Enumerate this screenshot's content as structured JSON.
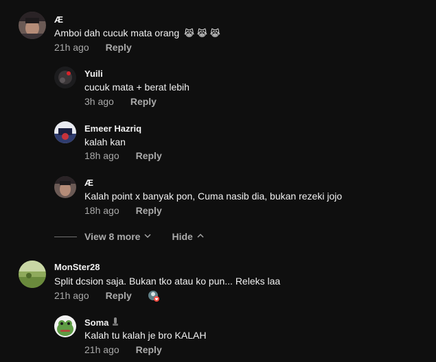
{
  "comments": [
    {
      "author": "Æ",
      "text": "Amboi dah cucuk mata orang",
      "emoji": "😹 😹 😹",
      "time": "21h ago",
      "reply": "Reply"
    },
    {
      "author": "Yuili",
      "text": "cucuk mata + berat lebih",
      "time": "3h ago",
      "reply": "Reply"
    },
    {
      "author": "Emeer Hazriq",
      "text": "kalah kan",
      "time": "18h ago",
      "reply": "Reply"
    },
    {
      "author": "Æ",
      "text": "Kalah point x banyak pon, Cuma nasib dia, bukan rezeki jojo",
      "time": "18h ago",
      "reply": "Reply"
    },
    {
      "author": "MonSter28",
      "text": "Split dcsion saja. Bukan tko atau ko pun... Releks laa",
      "time": "21h ago",
      "reply": "Reply"
    },
    {
      "author": "Soma",
      "text": "Kalah tu kalah je bro KALAH",
      "time": "21h ago",
      "reply": "Reply"
    }
  ],
  "thread": {
    "view_more": "View 8 more",
    "hide": "Hide"
  },
  "icons": {
    "chevron_down": "chevron-down-icon",
    "chevron_up": "chevron-up-icon",
    "creator_heart": "creator-heart-icon",
    "badge": "badge-icon"
  }
}
